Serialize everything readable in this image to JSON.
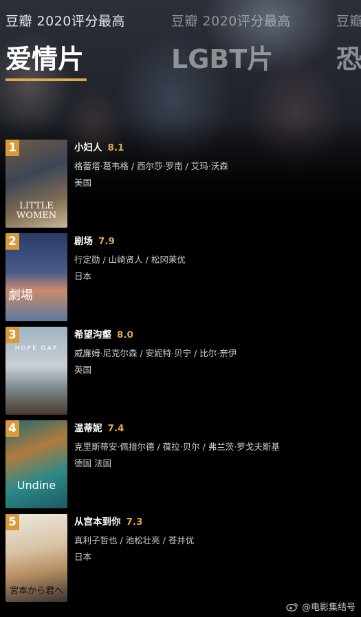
{
  "tabs": [
    {
      "sub": "豆瓣 2020评分最高",
      "main": "爱情片"
    },
    {
      "sub": "豆瓣 2020评分最高",
      "main": "LGBT片"
    },
    {
      "sub": "豆瓣",
      "main": "恐"
    }
  ],
  "movies": [
    {
      "rank": "1",
      "title": "小妇人",
      "rating": "8.1",
      "cast": "格蕾塔·葛韦格 / 西尔莎·罗南 / 艾玛·沃森",
      "region": "美国",
      "poster_text": "LITTLE\nWOMEN",
      "poster_colors": [
        "#8a6a4a",
        "#3a4a5e",
        "#c7b38a"
      ]
    },
    {
      "rank": "2",
      "title": "剧场",
      "rating": "7.9",
      "cast": "行定勋 / 山崎贤人 / 松冈茉优",
      "region": "日本",
      "poster_text": "劇場",
      "poster_colors": [
        "#2a3a6a",
        "#c98a6a",
        "#6a8ab0"
      ]
    },
    {
      "rank": "3",
      "title": "希望沟壑",
      "rating": "8.0",
      "cast": "威廉姆·尼克尔森 / 安妮特·贝宁 / 比尔·奈伊",
      "region": "英国",
      "poster_text": "HOPE GAP",
      "poster_colors": [
        "#8aa2b4",
        "#b9c4c8",
        "#5a4a3a"
      ]
    },
    {
      "rank": "4",
      "title": "温蒂妮",
      "rating": "7.4",
      "cast": "克里斯蒂安·佩措尔德 / 葆拉·贝尔 / 弗兰茨·罗戈夫斯基",
      "region": "德国 法国",
      "poster_text": "Undine",
      "poster_colors": [
        "#1e6e74",
        "#b87a3a",
        "#2a8a8a"
      ]
    },
    {
      "rank": "5",
      "title": "从宫本到你",
      "rating": "7.3",
      "cast": "真利子哲也 / 池松壮亮 / 苍井优",
      "region": "日本",
      "poster_text": "宮本から君へ",
      "poster_colors": [
        "#e8e4dc",
        "#c49a6a",
        "#2a2a2a"
      ]
    }
  ],
  "watermark": "@电影集结号",
  "colors": {
    "accent": "#e2a84e",
    "rank_bg": "#d99a3c",
    "rating": "#e3a64d"
  }
}
